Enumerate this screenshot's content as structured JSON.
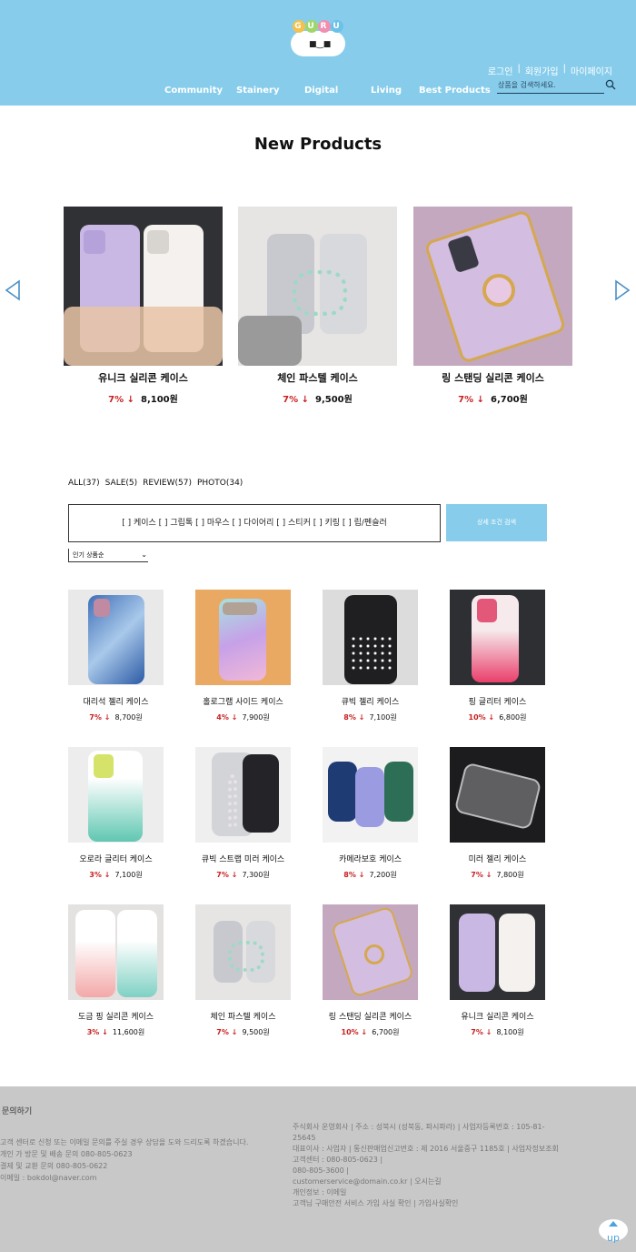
{
  "header": {
    "logo_alt": "GURU",
    "logo_letters": [
      "G",
      "U",
      "R",
      "U"
    ],
    "top_links": [
      "로그인",
      "|",
      "회원가입",
      "|",
      "마이페이지"
    ],
    "nav": [
      "Community",
      "Stainery",
      "Digital",
      "Living",
      "Best Products"
    ],
    "search_placeholder": "상품을 검색하세요."
  },
  "new_products": {
    "title": "New Products",
    "items": [
      {
        "name": "유니크 실리콘 케이스",
        "discount": "7% ↓",
        "price": "8,100원"
      },
      {
        "name": "체인 파스텔 케이스",
        "discount": "7% ↓",
        "price": "9,500원"
      },
      {
        "name": "링 스탠딩 실리콘 케이스",
        "discount": "7% ↓",
        "price": "6,700원"
      }
    ]
  },
  "tabs": [
    "ALL(37)",
    "SALE(5)",
    "REVIEW(57)",
    "PHOTO(34)"
  ],
  "filter": {
    "options": "[ ] 케이스 [ ] 그립톡 [ ] 마우스 [ ] 다이어리 [ ] 스티커 [ ] 키링 [ ] 립/펜슬러",
    "button": "상세 조건 검색",
    "sort": "인기 상품순"
  },
  "products": [
    {
      "name": "대리석 젤리 케이스",
      "discount": "7% ↓",
      "price": "8,700원"
    },
    {
      "name": "홀로그램 사이드 케이스",
      "discount": "4% ↓",
      "price": "7,900원"
    },
    {
      "name": "큐빅 젤리 케이스",
      "discount": "8% ↓",
      "price": "7,100원"
    },
    {
      "name": "핑 글리터 케이스",
      "discount": "10% ↓",
      "price": "6,800원"
    },
    {
      "name": "오로라 글리터 케이스",
      "discount": "3% ↓",
      "price": "7,100원"
    },
    {
      "name": "큐빅 스트랩 미러 케이스",
      "discount": "7% ↓",
      "price": "7,300원"
    },
    {
      "name": "카메라보호 케이스",
      "discount": "8% ↓",
      "price": "7,200원"
    },
    {
      "name": "미러 젤리 케이스",
      "discount": "7% ↓",
      "price": "7,800원"
    },
    {
      "name": "도금 핑 실리콘 케이스",
      "discount": "3% ↓",
      "price": "11,600원"
    },
    {
      "name": "체인 파스텔 케이스",
      "discount": "7% ↓",
      "price": "9,500원"
    },
    {
      "name": "링 스탠딩 실리콘 케이스",
      "discount": "10% ↓",
      "price": "6,700원"
    },
    {
      "name": "유니크 실리콘 케이스",
      "discount": "7% ↓",
      "price": "8,100원"
    }
  ],
  "footer": {
    "title": "문의하기",
    "left": [
      "고객 센터로 신청 또는 이메일 문의를 주실 경우 상담을 도와 드리도록 하겠습니다.",
      "개인 가 방문 및 배송 문의 080-805-0623",
      "결제 및 교환 문의 080-805-0622",
      "이메일 : bokdol@naver.com"
    ],
    "right": [
      "주식회사 운영회사 | 주소 : 성북시 (성북동, 파시파라) | 사업자등록번호 : 105-81-25645",
      "대표이사 : 사업자 | 통신판매업신고번호 : 제 2016 서울중구 1185호 | 사업자정보조회",
      "고객센터 : 080-805-0623 |",
      "080-805-3600 |",
      "customerservice@domain.co.kr | 오시는길",
      "개인정보 : 이메일",
      "고객님 구매안전 서비스 가입 사실 확인 | 가입사실확인"
    ]
  }
}
